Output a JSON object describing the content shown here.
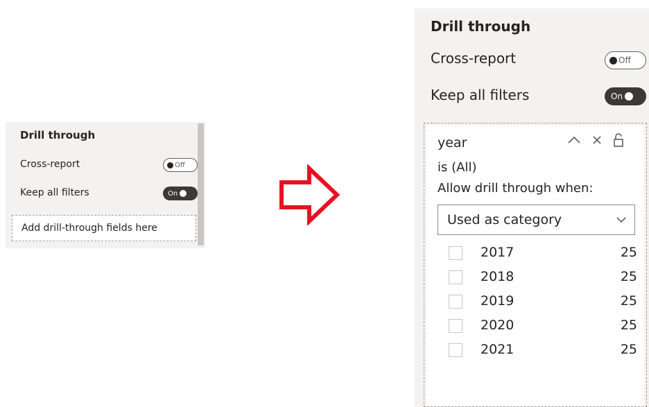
{
  "small_panel": {
    "title": "Drill through",
    "cross_report_label": "Cross-report",
    "cross_report_state": "Off",
    "keep_filters_label": "Keep all filters",
    "keep_filters_state": "On",
    "drop_placeholder": "Add drill-through fields here"
  },
  "large_panel": {
    "title": "Drill through",
    "cross_report_label": "Cross-report",
    "cross_report_state": "Off",
    "keep_filters_label": "Keep all filters",
    "keep_filters_state": "On",
    "field_name": "year",
    "filter_state": "is (All)",
    "allow_label": "Allow drill through when:",
    "allow_selected": "Used as category",
    "values": [
      {
        "label": "2017",
        "count": "25"
      },
      {
        "label": "2018",
        "count": "25"
      },
      {
        "label": "2019",
        "count": "25"
      },
      {
        "label": "2020",
        "count": "25"
      },
      {
        "label": "2021",
        "count": "25"
      }
    ]
  },
  "icons": [
    "arrow-right-icon",
    "chevron-up-icon",
    "close-icon",
    "lock-icon",
    "chevron-down-icon"
  ],
  "colors": {
    "arrow": "#e81123",
    "toggle_on": "#3b3a39",
    "panel_bg": "#f3f2f1"
  }
}
